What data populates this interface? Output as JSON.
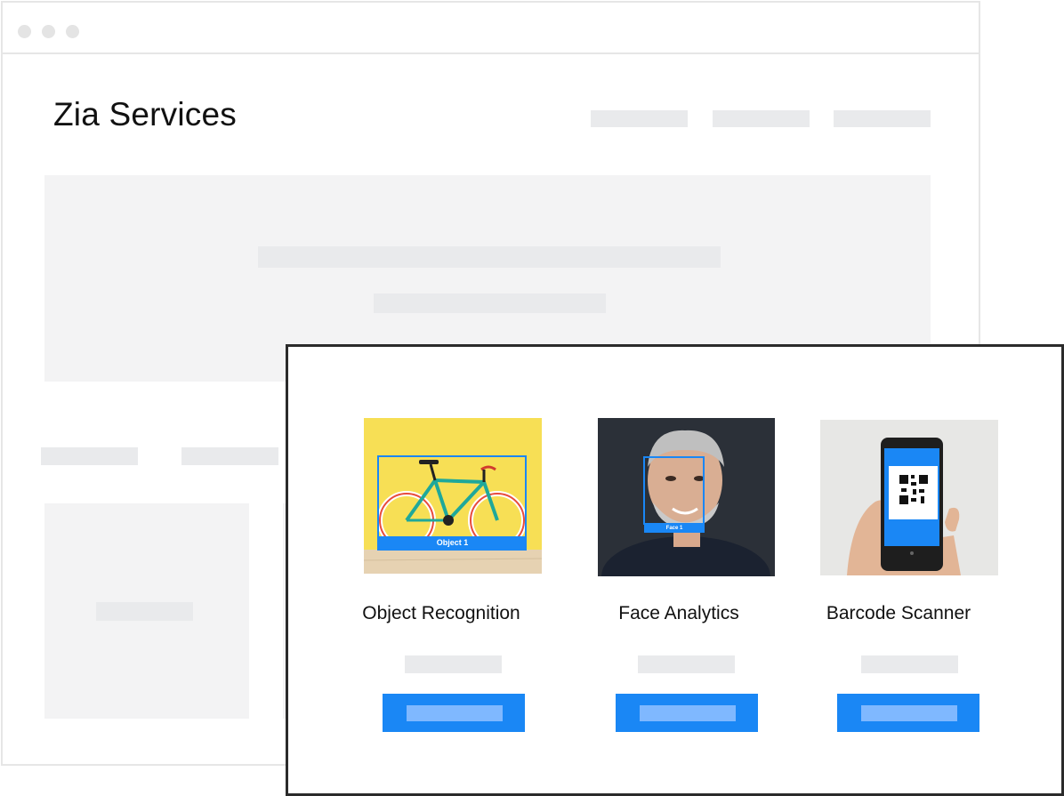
{
  "app": {
    "title": "Zia Services"
  },
  "cards": [
    {
      "title": "Object Recognition",
      "tag": "Object 1",
      "icon": "bicycle-photo"
    },
    {
      "title": "Face Analytics",
      "tag": "Face 1",
      "icon": "face-photo"
    },
    {
      "title": "Barcode Scanner",
      "icon": "phone-qr-photo"
    }
  ],
  "colors": {
    "accent": "#1a87f5",
    "placeholder": "#e9eaec",
    "button_inner": "#7fb8ff"
  }
}
